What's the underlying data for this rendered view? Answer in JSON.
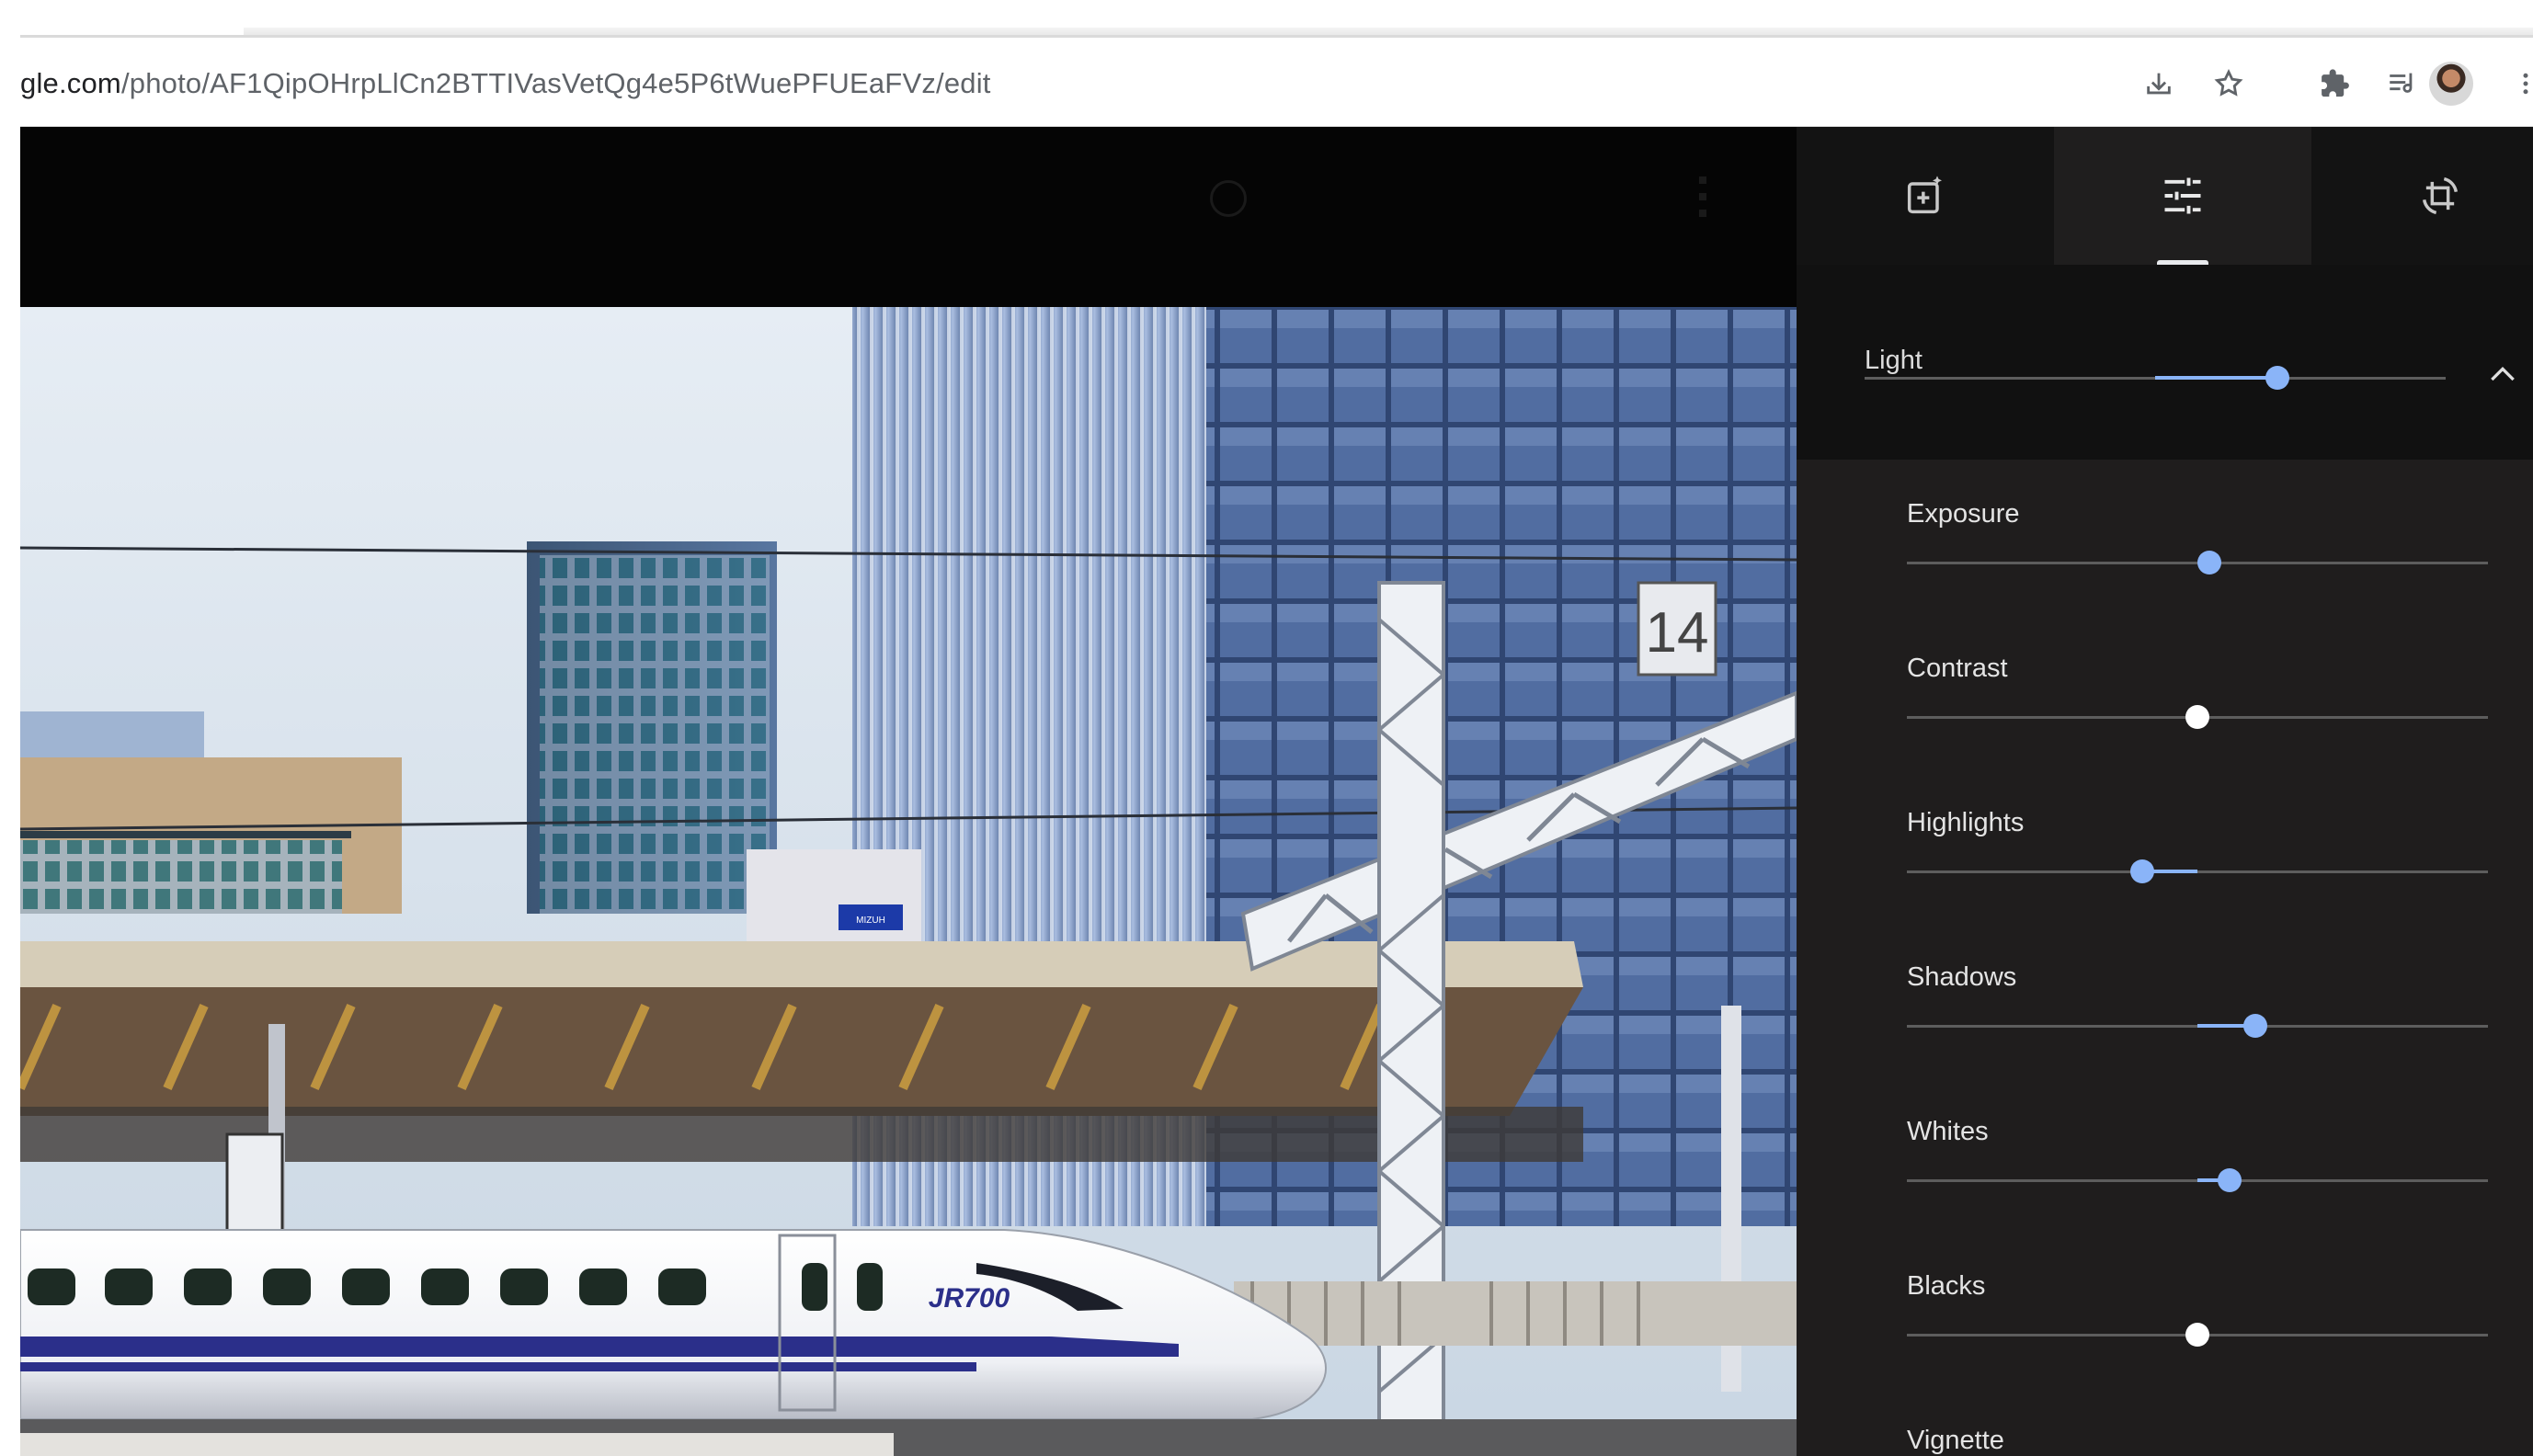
{
  "browser": {
    "url_domain": "gle.com",
    "url_path": "/photo/AF1QipOHrpLlCn2BTTIVasVetQg4e5P6tWuePFUEaFVz/edit",
    "icons": [
      "install-icon",
      "bookmark-star-icon",
      "extensions-puzzle-icon",
      "reading-list-icon",
      "profile-avatar",
      "more-vert-icon"
    ]
  },
  "editor": {
    "photo": {
      "train_text": "JR700",
      "platform_number": "14",
      "sign_text": "MIZUH"
    },
    "panel_tabs": [
      {
        "name": "suggestions",
        "icon": "auto-enhance-icon",
        "active": false
      },
      {
        "name": "adjust",
        "icon": "tune-sliders-icon",
        "active": true
      },
      {
        "name": "crop",
        "icon": "crop-rotate-icon",
        "active": false
      }
    ],
    "section": {
      "title": "Light",
      "value": 0.71,
      "fill_from": 0.5,
      "expanded": true
    },
    "sliders": [
      {
        "label": "Exposure",
        "value": 0.52,
        "color": "#8ab4f8",
        "fill": false
      },
      {
        "label": "Contrast",
        "value": 0.5,
        "color": "#ffffff",
        "fill": false
      },
      {
        "label": "Highlights",
        "value": 0.405,
        "color": "#8ab4f8",
        "fill": true
      },
      {
        "label": "Shadows",
        "value": 0.6,
        "color": "#8ab4f8",
        "fill": true
      },
      {
        "label": "Whites",
        "value": 0.555,
        "color": "#8ab4f8",
        "fill": true
      },
      {
        "label": "Blacks",
        "value": 0.5,
        "color": "#ffffff",
        "fill": false
      },
      {
        "label": "Vignette",
        "value": null,
        "color": "#8ab4f8",
        "fill": false
      }
    ],
    "colors": {
      "accent": "#8ab4f8",
      "panel_bg": "#1f1d1d",
      "section_bg": "#111111"
    }
  }
}
